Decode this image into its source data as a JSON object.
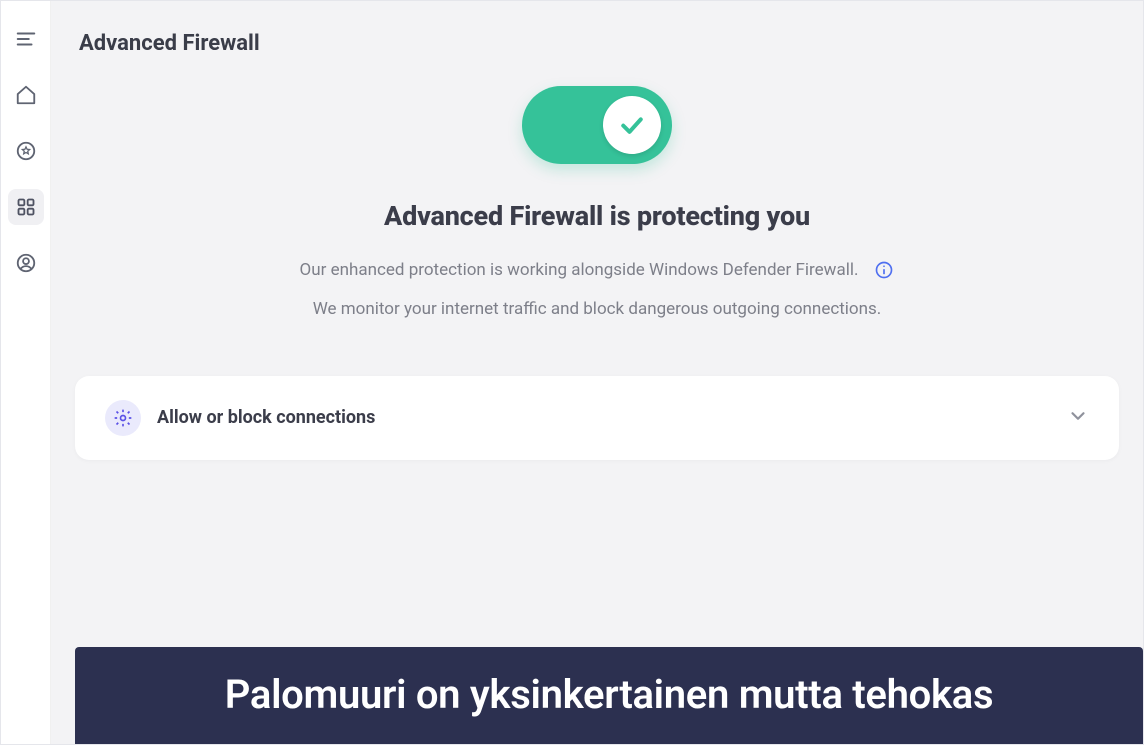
{
  "page": {
    "title": "Advanced Firewall"
  },
  "hero": {
    "heading": "Advanced Firewall is protecting you",
    "line1": "Our enhanced protection is working alongside Windows Defender Firewall.",
    "line2": "We monitor your internet traffic and block dangerous outgoing connections."
  },
  "card": {
    "title": "Allow or block connections"
  },
  "caption": "Palomuuri on yksinkertainen mutta tehokas",
  "sidebar": {
    "items": [
      "menu",
      "home",
      "shield-star",
      "grid",
      "profile"
    ],
    "active_index": 3
  },
  "colors": {
    "accent_toggle": "#35c299",
    "accent_info": "#4f6ff0",
    "card_icon_bg": "#eaeafc",
    "card_icon_fg": "#5b51e6",
    "banner_bg": "#2c3050"
  }
}
